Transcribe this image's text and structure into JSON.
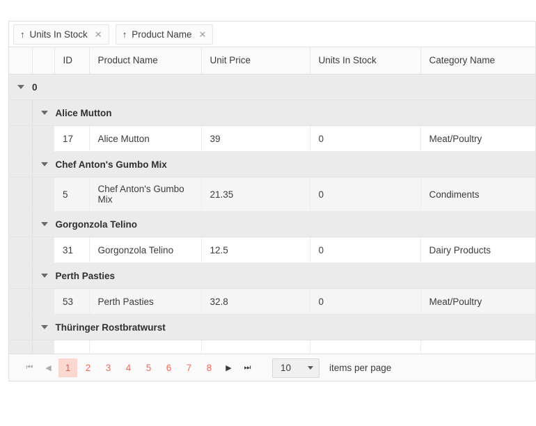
{
  "group_panel": {
    "chips": [
      {
        "label": "Units In Stock",
        "direction_icon": "arrow-up-icon",
        "direction": "↑",
        "remove": "✕"
      },
      {
        "label": "Product Name",
        "direction_icon": "arrow-up-icon",
        "direction": "↑",
        "remove": "✕"
      }
    ]
  },
  "table": {
    "columns": [
      {
        "key": "expand1",
        "label": ""
      },
      {
        "key": "expand2",
        "label": ""
      },
      {
        "key": "id",
        "label": "ID"
      },
      {
        "key": "product_name",
        "label": "Product Name"
      },
      {
        "key": "unit_price",
        "label": "Unit Price"
      },
      {
        "key": "units_in_stock",
        "label": "Units In Stock"
      },
      {
        "key": "category_name",
        "label": "Category Name"
      }
    ],
    "outer_group": {
      "label": "0",
      "expanded": true
    },
    "groups": [
      {
        "label": "Alice Mutton",
        "expanded": true,
        "rows": [
          {
            "id": "17",
            "product_name": "Alice Mutton",
            "unit_price": "39",
            "units_in_stock": "0",
            "category_name": "Meat/Poultry"
          }
        ]
      },
      {
        "label": "Chef Anton's Gumbo Mix",
        "expanded": true,
        "rows": [
          {
            "id": "5",
            "product_name": "Chef Anton's Gumbo Mix",
            "unit_price": "21.35",
            "units_in_stock": "0",
            "category_name": "Condiments"
          }
        ]
      },
      {
        "label": "Gorgonzola Telino",
        "expanded": true,
        "rows": [
          {
            "id": "31",
            "product_name": "Gorgonzola Telino",
            "unit_price": "12.5",
            "units_in_stock": "0",
            "category_name": "Dairy Products"
          }
        ]
      },
      {
        "label": "Perth Pasties",
        "expanded": true,
        "rows": [
          {
            "id": "53",
            "product_name": "Perth Pasties",
            "unit_price": "32.8",
            "units_in_stock": "0",
            "category_name": "Meat/Poultry"
          }
        ]
      },
      {
        "label": "Thüringer Rostbratwurst",
        "expanded": true,
        "rows": []
      }
    ]
  },
  "pager": {
    "first": "⏮",
    "prev": "◀",
    "next": "▶",
    "last": "⏭",
    "first_enabled": false,
    "prev_enabled": false,
    "next_enabled": true,
    "last_enabled": true,
    "pages": [
      "1",
      "2",
      "3",
      "4",
      "5",
      "6",
      "7",
      "8"
    ],
    "selected_page": "1",
    "page_size": "10",
    "page_size_label": "items per page",
    "caret_icon": "chevron-down-icon"
  },
  "colors": {
    "accent": "#f36a5a",
    "accent_selected_bg": "#fbd7d2",
    "group_row_bg": "#ebebeb",
    "alt_row_bg": "#f5f5f5",
    "header_bg": "#fafafa",
    "border": "#e0e0e0"
  }
}
